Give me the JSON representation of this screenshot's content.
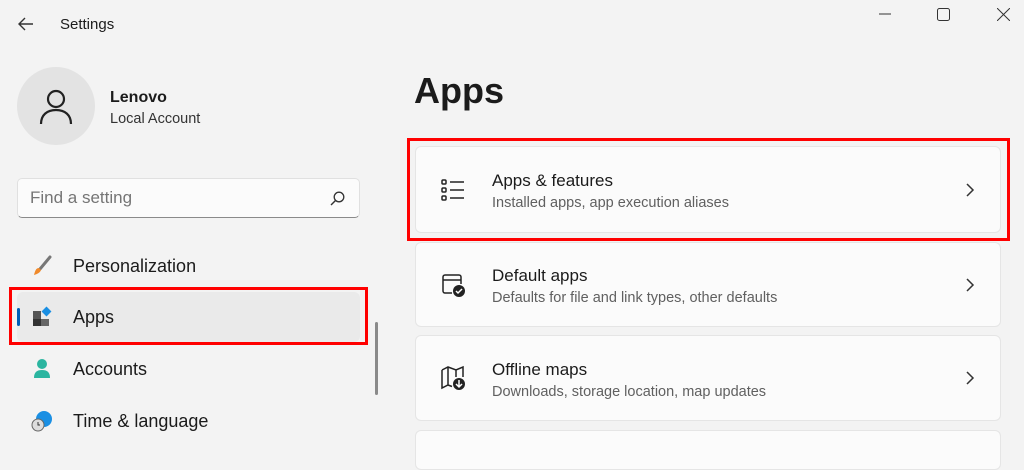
{
  "window": {
    "title": "Settings",
    "controls": [
      "minimize",
      "maximize",
      "close"
    ]
  },
  "account": {
    "name": "Lenovo",
    "type": "Local Account"
  },
  "search": {
    "placeholder": "Find a setting"
  },
  "sidebar": {
    "items": [
      {
        "label": "Personalization",
        "icon": "brush-icon"
      },
      {
        "label": "Apps",
        "icon": "apps-icon",
        "selected": true
      },
      {
        "label": "Accounts",
        "icon": "person-icon"
      },
      {
        "label": "Time & language",
        "icon": "globe-clock-icon"
      }
    ]
  },
  "main": {
    "title": "Apps",
    "cards": [
      {
        "title": "Apps & features",
        "subtitle": "Installed apps, app execution aliases"
      },
      {
        "title": "Default apps",
        "subtitle": "Defaults for file and link types, other defaults"
      },
      {
        "title": "Offline maps",
        "subtitle": "Downloads, storage location, map updates"
      }
    ]
  },
  "colors": {
    "accent": "#005fb8",
    "highlight": "#ff0000",
    "background": "#f3f3f3"
  }
}
